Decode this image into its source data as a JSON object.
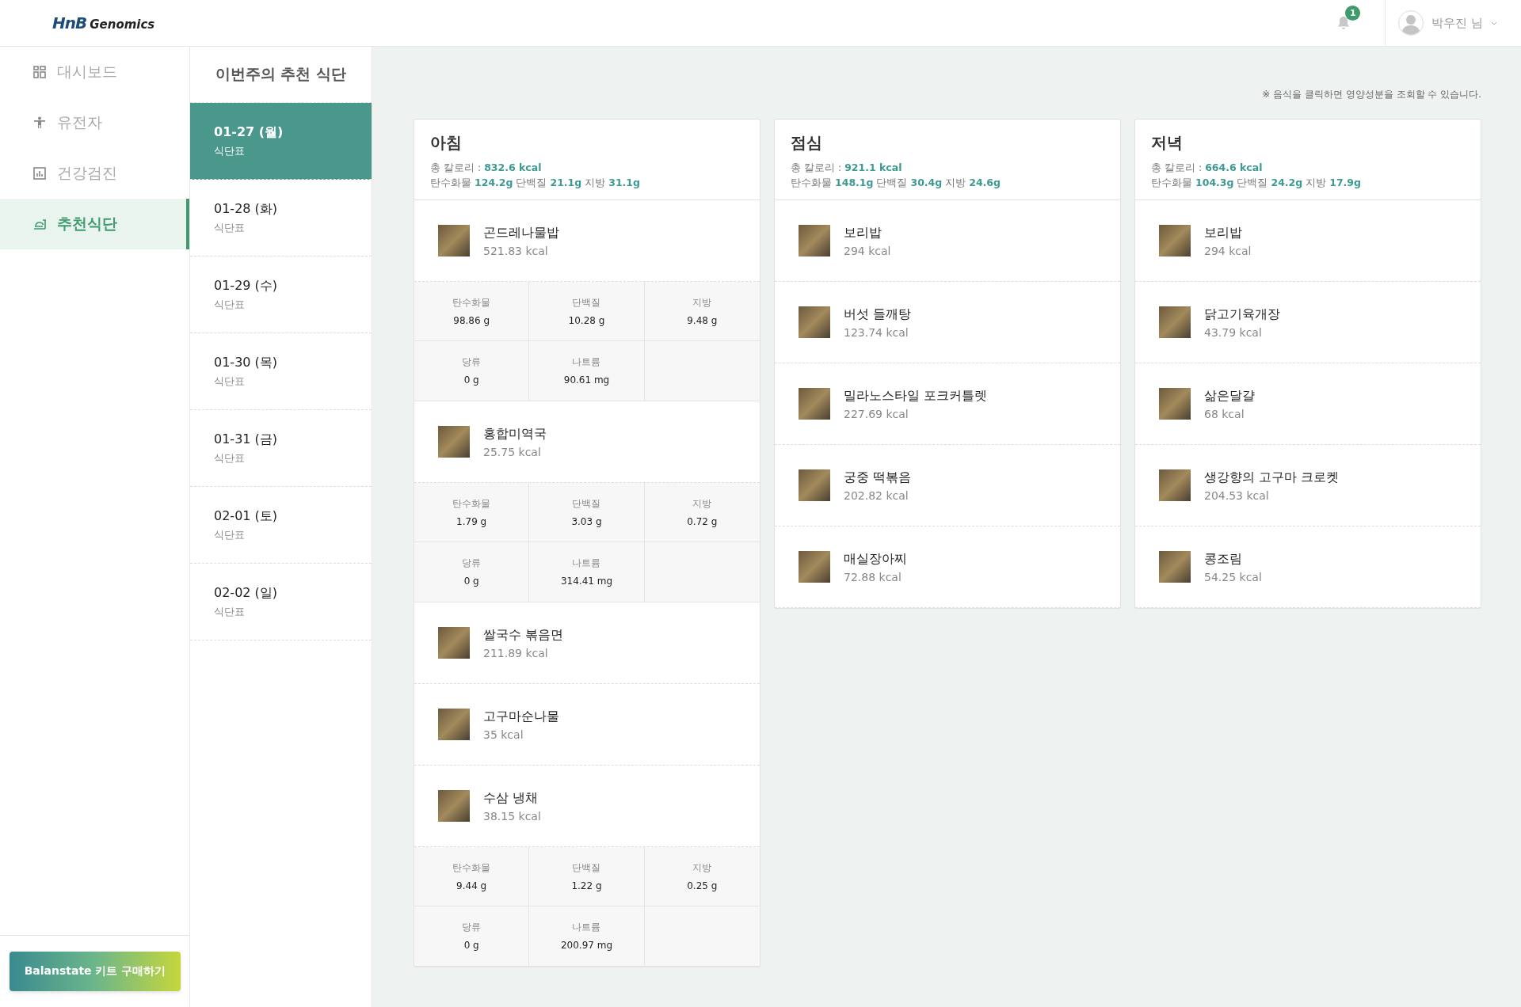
{
  "logo": {
    "mark": "HnB",
    "name": "Genomics"
  },
  "header": {
    "notification_count": "1",
    "user_name": "박우진 님"
  },
  "sidebar": {
    "items": [
      {
        "label": "대시보드",
        "selected": false
      },
      {
        "label": "유전자",
        "selected": false
      },
      {
        "label": "건강검진",
        "selected": false
      },
      {
        "label": "추천식단",
        "selected": true
      }
    ],
    "button": "Balanstate 키트 구매하기"
  },
  "week": {
    "title": "이번주의 추천 식단",
    "days": [
      {
        "date": "01-27 (월)",
        "sub": "식단표",
        "selected": true
      },
      {
        "date": "01-28 (화)",
        "sub": "식단표",
        "selected": false
      },
      {
        "date": "01-29 (수)",
        "sub": "식단표",
        "selected": false
      },
      {
        "date": "01-30 (목)",
        "sub": "식단표",
        "selected": false
      },
      {
        "date": "01-31 (금)",
        "sub": "식단표",
        "selected": false
      },
      {
        "date": "02-01 (토)",
        "sub": "식단표",
        "selected": false
      },
      {
        "date": "02-02 (일)",
        "sub": "식단표",
        "selected": false
      }
    ]
  },
  "note": "※ 음식을 클릭하면 영양성분을 조회할 수 있습니다.",
  "meals": [
    {
      "title": "아침",
      "total": "총 칼로리 : **832.6 kcal**",
      "macros": "탄수화물 **124.2g** 단백질 **21.1g** 지방 **31.1g**",
      "foods": [
        {
          "name": "곤드레나물밥",
          "kcal": "521.83 kcal",
          "nutrients": [
            {
              "label": "탄수화물",
              "value": "98.86 g"
            },
            {
              "label": "단백질",
              "value": "10.28 g"
            },
            {
              "label": "지방",
              "value": "9.48 g"
            },
            {
              "label": "당류",
              "value": "0 g"
            },
            {
              "label": "나트륨",
              "value": "90.61 mg"
            }
          ]
        },
        {
          "name": "홍합미역국",
          "kcal": "25.75 kcal",
          "nutrients": [
            {
              "label": "탄수화물",
              "value": "1.79 g"
            },
            {
              "label": "단백질",
              "value": "3.03 g"
            },
            {
              "label": "지방",
              "value": "0.72 g"
            },
            {
              "label": "당류",
              "value": "0 g"
            },
            {
              "label": "나트륨",
              "value": "314.41 mg"
            }
          ]
        },
        {
          "name": "쌀국수 볶음면",
          "kcal": "211.89 kcal"
        },
        {
          "name": "고구마순나물",
          "kcal": "35 kcal"
        },
        {
          "name": "수삼 냉채",
          "kcal": "38.15 kcal",
          "nutrients": [
            {
              "label": "탄수화물",
              "value": "9.44 g"
            },
            {
              "label": "단백질",
              "value": "1.22 g"
            },
            {
              "label": "지방",
              "value": "0.25 g"
            },
            {
              "label": "당류",
              "value": "0 g"
            },
            {
              "label": "나트륨",
              "value": "200.97 mg"
            }
          ]
        }
      ]
    },
    {
      "title": "점심",
      "total": "총 칼로리 : **921.1 kcal**",
      "macros": "탄수화물 **148.1g** 단백질 **30.4g** 지방 **24.6g**",
      "foods": [
        {
          "name": "보리밥",
          "kcal": "294 kcal"
        },
        {
          "name": "버섯 들깨탕",
          "kcal": "123.74 kcal"
        },
        {
          "name": "밀라노스타일 포크커틀렛",
          "kcal": "227.69 kcal"
        },
        {
          "name": "궁중 떡볶음",
          "kcal": "202.82 kcal"
        },
        {
          "name": "매실장아찌",
          "kcal": "72.88 kcal"
        }
      ]
    },
    {
      "title": "저녁",
      "total": "총 칼로리 : **664.6 kcal**",
      "macros": "탄수화물 **104.3g** 단백질 **24.2g** 지방 **17.9g**",
      "foods": [
        {
          "name": "보리밥",
          "kcal": "294 kcal"
        },
        {
          "name": "닭고기육개장",
          "kcal": "43.79 kcal"
        },
        {
          "name": "삶은달걀",
          "kcal": "68 kcal"
        },
        {
          "name": "생강향의 고구마 크로켓",
          "kcal": "204.53 kcal"
        },
        {
          "name": "콩조림",
          "kcal": "54.25 kcal"
        }
      ]
    }
  ]
}
